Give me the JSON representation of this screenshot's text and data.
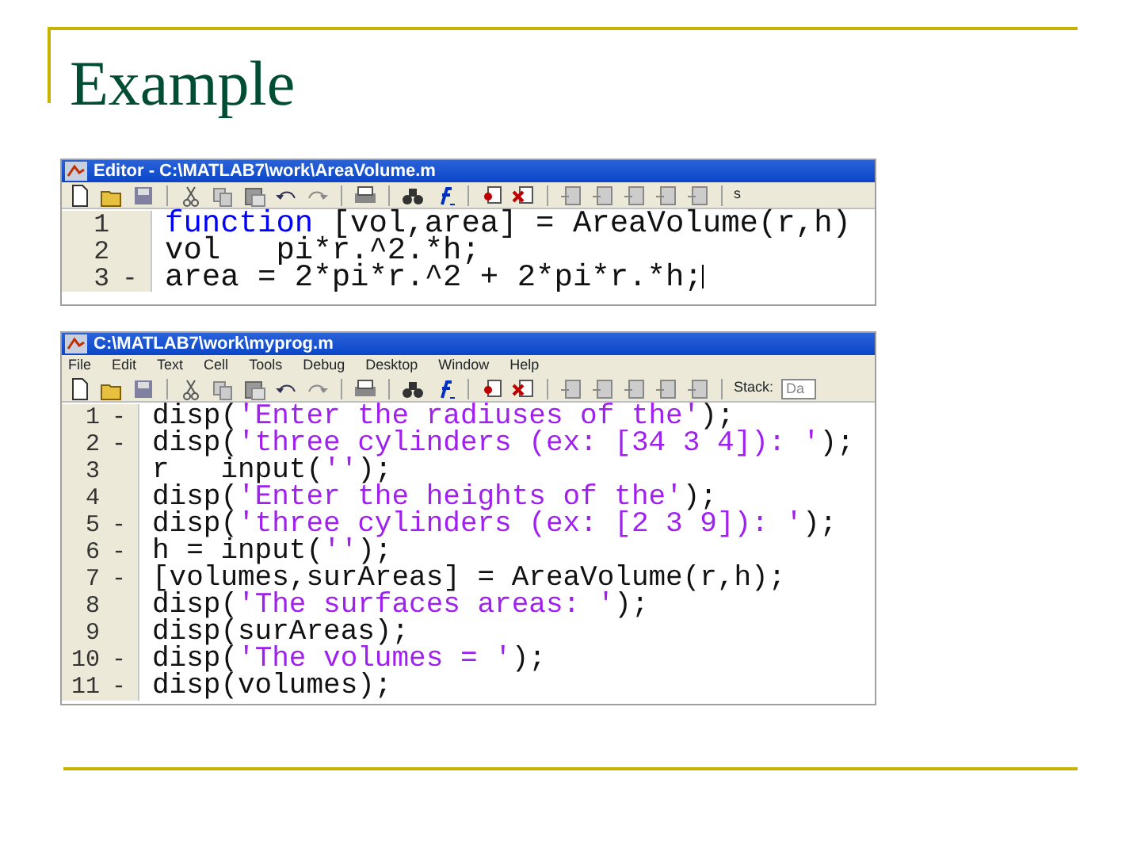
{
  "slide": {
    "title": "Example"
  },
  "editors": [
    {
      "title": "Editor - C:\\MATLAB7\\work\\AreaVolume.m",
      "toolbar_tail": [
        {
          "kind": "cut-label",
          "text": "s"
        }
      ],
      "lines": [
        {
          "number": "1",
          "segments": [
            {
              "kind": "keyword",
              "text": "function"
            },
            {
              "kind": "plain",
              "text": " [vol,area] = AreaVolume(r,h)"
            }
          ]
        },
        {
          "number": "2",
          "segments": [
            {
              "kind": "plain",
              "text": "vol   pi*r.^2.*h;"
            }
          ]
        },
        {
          "number": "3",
          "marker": "-",
          "cursor": true,
          "segments": [
            {
              "kind": "plain",
              "text": "area = 2*pi*r.^2 + 2*pi*r.*h;"
            }
          ]
        }
      ]
    },
    {
      "title": "C:\\MATLAB7\\work\\myprog.m",
      "menu": [
        "File",
        "Edit",
        "Text",
        "Cell",
        "Tools",
        "Debug",
        "Desktop",
        "Window",
        "Help"
      ],
      "toolbar_tail": [
        {
          "kind": "label",
          "text": "Stack:"
        },
        {
          "kind": "field",
          "text": "Da"
        }
      ],
      "lines": [
        {
          "number": "1",
          "marker": "-",
          "segments": [
            {
              "kind": "plain",
              "text": "disp("
            },
            {
              "kind": "string",
              "text": "'Enter the radiuses of the'"
            },
            {
              "kind": "plain",
              "text": ");"
            }
          ]
        },
        {
          "number": "2",
          "marker": "-",
          "segments": [
            {
              "kind": "plain",
              "text": "disp("
            },
            {
              "kind": "string",
              "text": "'three cylinders (ex: [34 3 4]): '"
            },
            {
              "kind": "plain",
              "text": ");"
            }
          ]
        },
        {
          "number": "3",
          "segments": [
            {
              "kind": "plain",
              "text": "r   input("
            },
            {
              "kind": "string",
              "text": "''"
            },
            {
              "kind": "plain",
              "text": ");"
            }
          ]
        },
        {
          "number": "4",
          "segments": [
            {
              "kind": "plain",
              "text": "disp("
            },
            {
              "kind": "string",
              "text": "'Enter the heights of the'"
            },
            {
              "kind": "plain",
              "text": ");"
            }
          ]
        },
        {
          "number": "5",
          "marker": "-",
          "segments": [
            {
              "kind": "plain",
              "text": "disp("
            },
            {
              "kind": "string",
              "text": "'three cylinders (ex: [2 3 9]): '"
            },
            {
              "kind": "plain",
              "text": ");"
            }
          ]
        },
        {
          "number": "6",
          "marker": "-",
          "segments": [
            {
              "kind": "plain",
              "text": "h = input("
            },
            {
              "kind": "string",
              "text": "''"
            },
            {
              "kind": "plain",
              "text": ");"
            }
          ]
        },
        {
          "number": "7",
          "marker": "-",
          "segments": [
            {
              "kind": "plain",
              "text": "[volumes,surAreas] = AreaVolume(r,h);"
            }
          ]
        },
        {
          "number": "8",
          "segments": [
            {
              "kind": "plain",
              "text": "disp("
            },
            {
              "kind": "string",
              "text": "'The surfaces areas: '"
            },
            {
              "kind": "plain",
              "text": ");"
            }
          ]
        },
        {
          "number": "9",
          "segments": [
            {
              "kind": "plain",
              "text": "disp(surAreas);"
            }
          ]
        },
        {
          "number": "10",
          "marker": "-",
          "segments": [
            {
              "kind": "plain",
              "text": "disp("
            },
            {
              "kind": "string",
              "text": "'The volumes = '"
            },
            {
              "kind": "plain",
              "text": ");"
            }
          ]
        },
        {
          "number": "11",
          "marker": "-",
          "segments": [
            {
              "kind": "plain",
              "text": "disp(volumes);"
            }
          ]
        }
      ]
    }
  ]
}
